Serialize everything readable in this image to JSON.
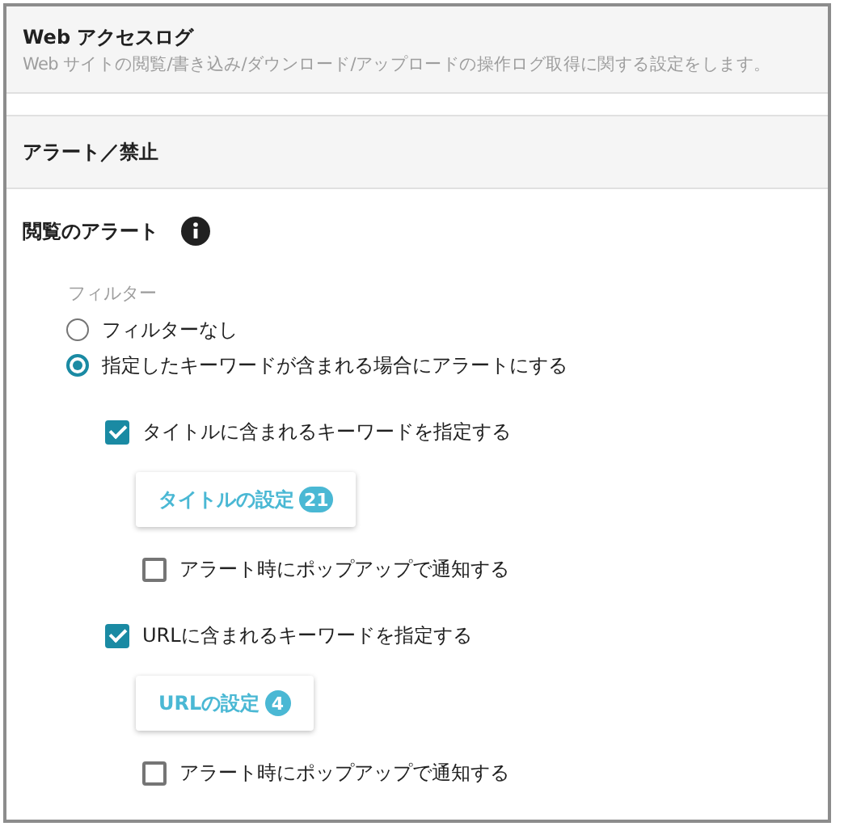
{
  "header": {
    "title": "Web アクセスログ",
    "description": "Web サイトの閲覧/書き込み/ダウンロード/アップロードの操作ログ取得に関する設定をします。"
  },
  "section": {
    "title": "アラート／禁止"
  },
  "group": {
    "title": "閲覧のアラート",
    "filter_label": "フィルター",
    "radios": [
      {
        "label": "フィルターなし",
        "selected": false
      },
      {
        "label": "指定したキーワードが含まれる場合にアラートにする",
        "selected": true
      }
    ],
    "keyword_options": [
      {
        "label": "タイトルに含まれるキーワードを指定する",
        "checked": true,
        "button": {
          "label": "タイトルの設定",
          "count": "21"
        },
        "popup": {
          "label": "アラート時にポップアップで通知する",
          "checked": false
        }
      },
      {
        "label": "URLに含まれるキーワードを指定する",
        "checked": true,
        "button": {
          "label": "URLの設定",
          "count": "4"
        },
        "popup": {
          "label": "アラート時にポップアップで通知する",
          "checked": false
        }
      }
    ]
  }
}
